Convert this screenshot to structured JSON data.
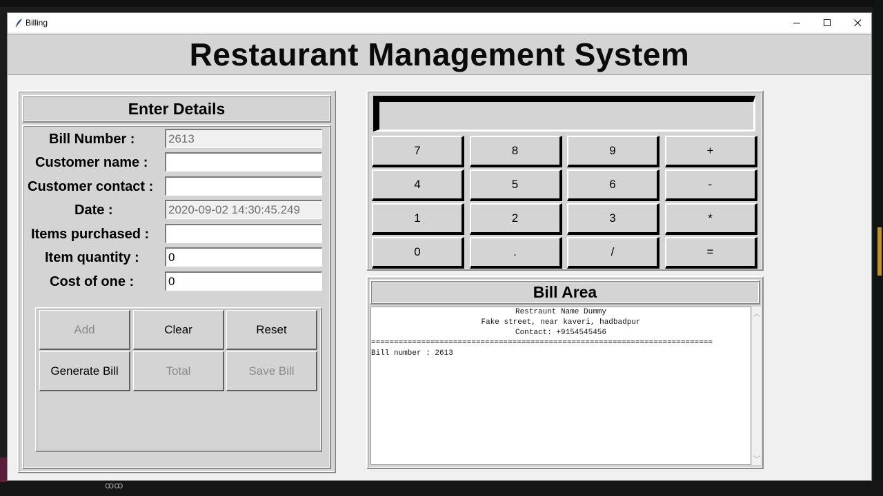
{
  "window": {
    "title": "Billing",
    "minimize_glyph": "—",
    "maximize_glyph": "☐",
    "close_glyph": "✕"
  },
  "header": {
    "title": "Restaurant Management System"
  },
  "details": {
    "heading": "Enter Details",
    "fields": [
      {
        "label": "Bill Number :",
        "value": "2613",
        "readonly": true
      },
      {
        "label": "Customer name :",
        "value": "",
        "readonly": false
      },
      {
        "label": "Customer contact :",
        "value": "",
        "readonly": false
      },
      {
        "label": "Date :",
        "value": "2020-09-02 14:30:45.249",
        "readonly": true
      },
      {
        "label": "Items purchased :",
        "value": "",
        "readonly": false
      },
      {
        "label": "Item quantity :",
        "value": "0",
        "readonly": false
      },
      {
        "label": "Cost of one :",
        "value": "0",
        "readonly": false
      }
    ],
    "buttons": [
      {
        "label": "Add",
        "enabled": false
      },
      {
        "label": "Clear",
        "enabled": true
      },
      {
        "label": "Reset",
        "enabled": true
      },
      {
        "label": "Generate Bill",
        "enabled": true
      },
      {
        "label": "Total",
        "enabled": false
      },
      {
        "label": "Save Bill",
        "enabled": false
      }
    ]
  },
  "calculator": {
    "display": "",
    "keys": [
      "7",
      "8",
      "9",
      "+",
      "4",
      "5",
      "6",
      "-",
      "1",
      "2",
      "3",
      "*",
      "0",
      ".",
      "/",
      "="
    ]
  },
  "bill_area": {
    "heading": "Bill Area",
    "lines": [
      "Restraunt Name Dummy",
      "Fake street, near kaveri, hadbadpur",
      "Contact: +9154545456",
      "===========================================================================",
      "Bill number : 2613"
    ]
  },
  "taskbar": {
    "glyph": "ꝏꝏ"
  },
  "colors": {
    "window_bg": "#f0f0f0",
    "panel_bg": "#d4d4d4",
    "disabled_text": "#8a8a8a"
  }
}
